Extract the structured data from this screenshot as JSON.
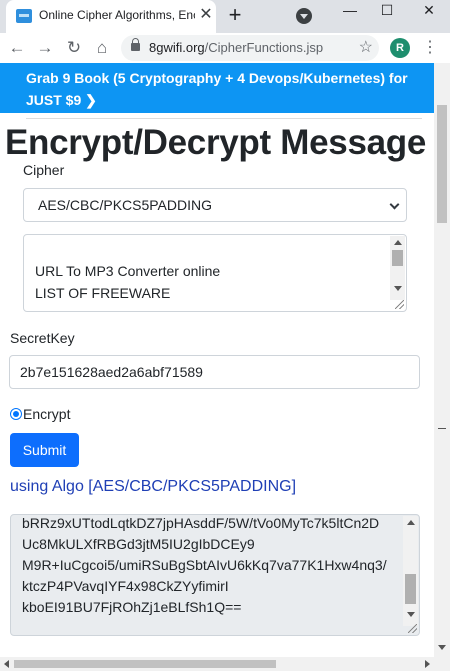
{
  "browser": {
    "tab_title": "Online Cipher Algorithms, Encry",
    "tab_close": "✕",
    "new_tab": "+",
    "window_minimize": "—",
    "window_maximize": "☐",
    "window_close": "✕",
    "back": "←",
    "forward": "→",
    "reload": "↻",
    "home": "⌂",
    "url_domain": "8gwifi.org",
    "url_path": "/CipherFunctions.jsp",
    "bookmark": "☆",
    "profile_initial": "R",
    "menu": "⋮"
  },
  "banner": {
    "line1": "Grab 9 Book (5 Cryptography + 4 Devops/Kubernetes) for",
    "line2": "JUST $9 ❯"
  },
  "page": {
    "title": "Encrypt/Decrypt Message",
    "cipher_label": "Cipher",
    "cipher_selected": "AES/CBC/PKCS5PADDING",
    "message_lines": [
      "URL To MP3 Converter online",
      "LIST OF FREEWARE"
    ],
    "secret_key_label": "SecretKey",
    "secret_key_value": "2b7e151628aed2a6abf71589",
    "mode_label": "Encrypt",
    "submit_label": "Submit",
    "algo_text": "using Algo [AES/CBC/PKCS5PADDING]",
    "output_lines": [
      "bRRz9xUTtodLqtkDZ7jpHAsddF/5W/tVo0MyTc7k5ltCn2D",
      "Uc8MkULXfRBGd3jtM5IU2gIbDCEy9",
      "M9R+IuCgcoi5/umiRSuBgSbtAIvU6kKq7va77K1Hxw4nq3/",
      "ktczP4PVavqIYF4x98CkZYyfimirI",
      "kboEI91BU7FjROhZj1eBLfSh1Q=="
    ]
  },
  "colors": {
    "banner": "#0d95f3",
    "button": "#0d6efd",
    "algo_text": "#1f3fb5"
  }
}
